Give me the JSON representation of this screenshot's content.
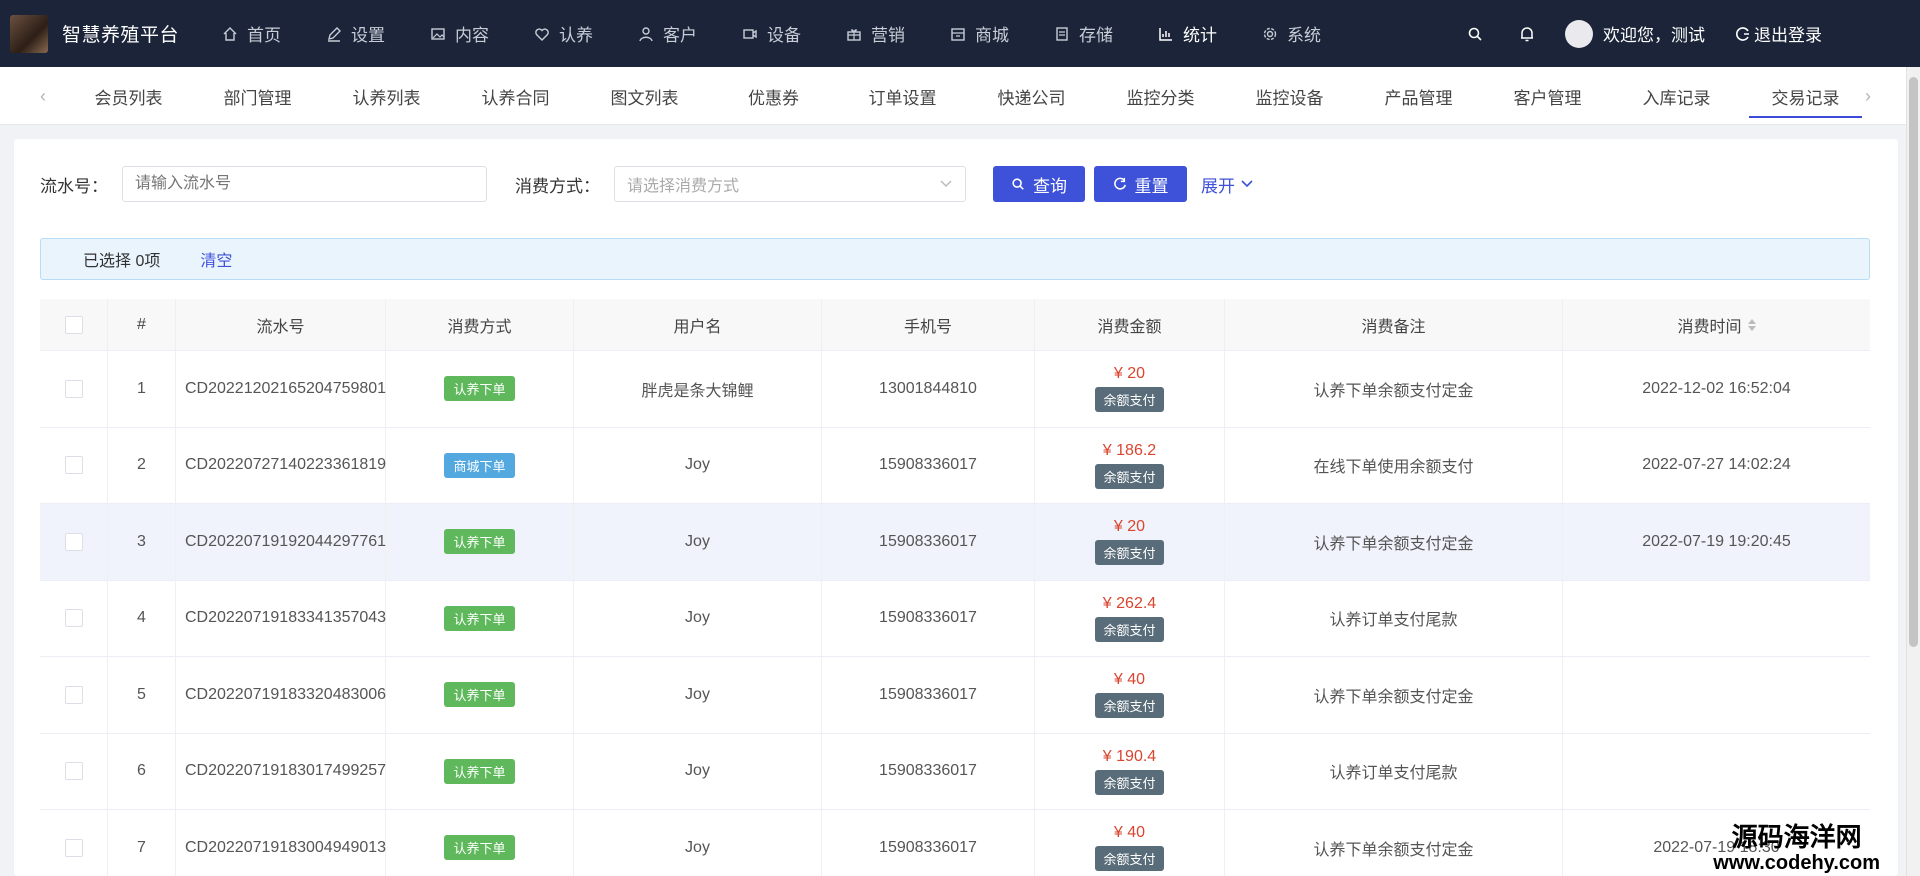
{
  "app": {
    "title": "智慧养殖平台"
  },
  "nav": {
    "items": [
      {
        "label": "首页",
        "icon": "home-icon"
      },
      {
        "label": "设置",
        "icon": "pencil-icon"
      },
      {
        "label": "内容",
        "icon": "image-icon"
      },
      {
        "label": "认养",
        "icon": "heart-icon"
      },
      {
        "label": "客户",
        "icon": "user-icon"
      },
      {
        "label": "设备",
        "icon": "video-icon"
      },
      {
        "label": "营销",
        "icon": "gift-icon"
      },
      {
        "label": "商城",
        "icon": "shop-icon"
      },
      {
        "label": "存储",
        "icon": "storage-icon"
      },
      {
        "label": "统计",
        "icon": "chart-icon"
      },
      {
        "label": "系统",
        "icon": "gear-icon"
      }
    ],
    "active": "统计",
    "welcome": "欢迎您，测试",
    "logout": "退出登录"
  },
  "tabs": [
    "会员列表",
    "部门管理",
    "认养列表",
    "认养合同",
    "图文列表",
    "优惠券",
    "订单设置",
    "快递公司",
    "监控分类",
    "监控设备",
    "产品管理",
    "客户管理",
    "入库记录",
    "交易记录"
  ],
  "active_tab": "交易记录",
  "filters": {
    "serial_label": "流水号：",
    "serial_placeholder": "请输入流水号",
    "method_label": "消费方式：",
    "method_placeholder": "请选择消费方式",
    "query": "查询",
    "reset": "重置",
    "expand": "展开"
  },
  "alert": {
    "selected": "已选择 0项",
    "clear": "清空"
  },
  "table": {
    "headers": [
      "#",
      "流水号",
      "消费方式",
      "用户名",
      "手机号",
      "消费金额",
      "消费备注",
      "消费时间"
    ],
    "rows": [
      {
        "no": "1",
        "serial": "CD20221202165204759801",
        "method": "认养下单",
        "method_color": "green",
        "user": "胖虎是条大锦鲤",
        "phone": "13001844810",
        "amount": "¥ 20",
        "pay": "余额支付",
        "note": "认养下单余额支付定金",
        "time": "2022-12-02 16:52:04"
      },
      {
        "no": "2",
        "serial": "CD20220727140223361819",
        "method": "商城下单",
        "method_color": "blue",
        "user": "Joy",
        "phone": "15908336017",
        "amount": "¥ 186.2",
        "pay": "余额支付",
        "note": "在线下单使用余额支付",
        "time": "2022-07-27 14:02:24"
      },
      {
        "no": "3",
        "serial": "CD20220719192044297761",
        "method": "认养下单",
        "method_color": "green",
        "user": "Joy",
        "phone": "15908336017",
        "amount": "¥ 20",
        "pay": "余额支付",
        "note": "认养下单余额支付定金",
        "time": "2022-07-19 19:20:45"
      },
      {
        "no": "4",
        "serial": "CD20220719183341357043",
        "method": "认养下单",
        "method_color": "green",
        "user": "Joy",
        "phone": "15908336017",
        "amount": "¥ 262.4",
        "pay": "余额支付",
        "note": "认养订单支付尾款",
        "time": ""
      },
      {
        "no": "5",
        "serial": "CD20220719183320483006",
        "method": "认养下单",
        "method_color": "green",
        "user": "Joy",
        "phone": "15908336017",
        "amount": "¥ 40",
        "pay": "余额支付",
        "note": "认养下单余额支付定金",
        "time": ""
      },
      {
        "no": "6",
        "serial": "CD20220719183017499257",
        "method": "认养下单",
        "method_color": "green",
        "user": "Joy",
        "phone": "15908336017",
        "amount": "¥ 190.4",
        "pay": "余额支付",
        "note": "认养订单支付尾款",
        "time": ""
      },
      {
        "no": "7",
        "serial": "CD20220719183004949013",
        "method": "认养下单",
        "method_color": "green",
        "user": "Joy",
        "phone": "15908336017",
        "amount": "¥ 40",
        "pay": "余额支付",
        "note": "认养下单余额支付定金",
        "time": "2022-07-19 18:30"
      }
    ],
    "highlight_row": "3"
  },
  "watermark": {
    "line1": "源码海洋网",
    "line2": "www.codehy.com"
  },
  "colors": {
    "nav_bg": "#1b2438",
    "primary": "#3d51d9",
    "tag_green": "#5fb85c",
    "tag_blue": "#54a8e0",
    "amount": "#d9452e",
    "pay_tag": "#596c79"
  }
}
